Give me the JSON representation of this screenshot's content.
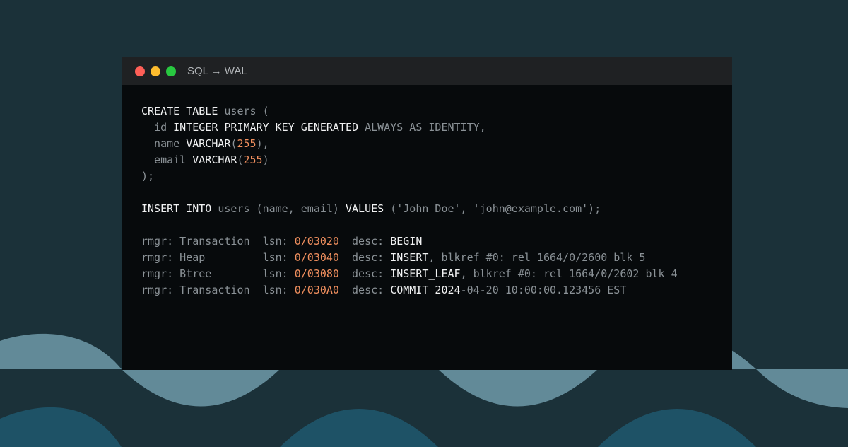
{
  "colors": {
    "background": "#1b3139",
    "wave_light": "#628a98",
    "wave_dark": "#1e5266",
    "window_bg": "#070a0c",
    "titlebar_bg": "#1f2123",
    "keyword": "#f1f2f3",
    "muted": "#8a9196",
    "number": "#f08f5e",
    "close_dot": "#fe5f57",
    "minimize_dot": "#febc2e",
    "maximize_dot": "#28c840"
  },
  "window": {
    "title": "SQL → WAL",
    "controls": [
      "close-dot",
      "minimize-dot",
      "maximize-dot"
    ]
  },
  "code_lines": [
    [
      [
        "kw",
        "CREATE TABLE "
      ],
      [
        "dim",
        "users ("
      ]
    ],
    [
      [
        "dim",
        "  id "
      ],
      [
        "kw",
        "INTEGER PRIMARY KEY GENERATED "
      ],
      [
        "dim",
        "ALWAYS AS IDENTITY,"
      ]
    ],
    [
      [
        "dim",
        "  name "
      ],
      [
        "kw",
        "VARCHAR"
      ],
      [
        "dim",
        "("
      ],
      [
        "num",
        "255"
      ],
      [
        "dim",
        "),"
      ]
    ],
    [
      [
        "dim",
        "  email "
      ],
      [
        "kw",
        "VARCHAR"
      ],
      [
        "dim",
        "("
      ],
      [
        "num",
        "255"
      ],
      [
        "dim",
        ")"
      ]
    ],
    [
      [
        "dim",
        ");"
      ]
    ],
    [
      [
        "dim",
        ""
      ]
    ],
    [
      [
        "kw",
        "INSERT INTO "
      ],
      [
        "dim",
        "users (name, email) "
      ],
      [
        "kw",
        "VALUES "
      ],
      [
        "dim",
        "('John Doe', 'john@example.com');"
      ]
    ],
    [
      [
        "dim",
        ""
      ]
    ],
    [
      [
        "dim",
        "rmgr: Transaction  lsn: "
      ],
      [
        "num",
        "0/03020"
      ],
      [
        "dim",
        "  desc: "
      ],
      [
        "kw",
        "BEGIN"
      ]
    ],
    [
      [
        "dim",
        "rmgr: Heap         lsn: "
      ],
      [
        "num",
        "0/03040"
      ],
      [
        "dim",
        "  desc: "
      ],
      [
        "kw",
        "INSERT"
      ],
      [
        "dim",
        ", blkref #0: rel 1664/0/2600 blk 5"
      ]
    ],
    [
      [
        "dim",
        "rmgr: Btree        lsn: "
      ],
      [
        "num",
        "0/03080"
      ],
      [
        "dim",
        "  desc: "
      ],
      [
        "kw",
        "INSERT_LEAF"
      ],
      [
        "dim",
        ", blkref #0: rel 1664/0/2602 blk 4"
      ]
    ],
    [
      [
        "dim",
        "rmgr: Transaction  lsn: "
      ],
      [
        "num",
        "0/030A0"
      ],
      [
        "dim",
        "  desc: "
      ],
      [
        "kw",
        "COMMIT 2024"
      ],
      [
        "dim",
        "-04-20 10:00:00.123456 EST"
      ]
    ]
  ]
}
